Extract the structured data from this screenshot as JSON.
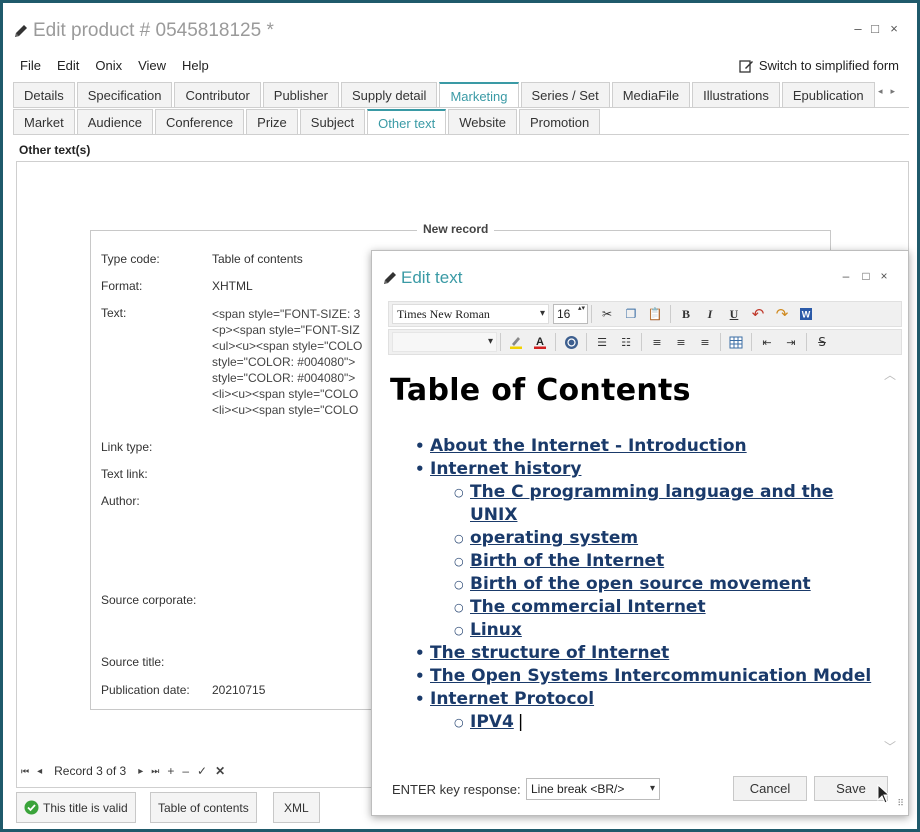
{
  "window": {
    "title": "Edit product # 0545818125 *",
    "controls": [
      "–",
      "□",
      "×"
    ]
  },
  "menu": [
    "File",
    "Edit",
    "Onix",
    "View",
    "Help"
  ],
  "simplified_label": "Switch to simplified form",
  "tabs_main": [
    "Details",
    "Specification",
    "Contributor",
    "Publisher",
    "Supply detail",
    "Marketing",
    "Series / Set",
    "MediaFile",
    "Illustrations",
    "Epublication"
  ],
  "tabs_main_active": "Marketing",
  "tabs_sub": [
    "Market",
    "Audience",
    "Conference",
    "Prize",
    "Subject",
    "Other text",
    "Website",
    "Promotion"
  ],
  "tabs_sub_active": "Other text",
  "section_title": "Other text(s)",
  "record": {
    "legend": "New record",
    "fields": {
      "type_code_label": "Type code:",
      "type_code_value": "Table of contents",
      "format_label": "Format:",
      "format_value": "XHTML",
      "text_label": "Text:",
      "text_lines": [
        "<span style=\"FONT-SIZE: 3",
        "<p><span style=\"FONT-SIZ",
        "<ul><u><span style=\"COLO",
        "style=\"COLOR: #004080\">",
        "style=\"COLOR: #004080\">",
        "<li><u><span style=\"COLO",
        "<li><u><span style=\"COLO"
      ],
      "link_type_label": "Link type:",
      "text_link_label": "Text link:",
      "author_label": "Author:",
      "source_corporate_label": "Source corporate:",
      "source_title_label": "Source title:",
      "publication_date_label": "Publication date:",
      "publication_date_value": "20210715"
    }
  },
  "navigator": {
    "record_text": "Record 3 of 3",
    "buttons": [
      "⏮",
      "◂",
      "▸",
      "⏭",
      "+",
      "–",
      "✓",
      "✕"
    ]
  },
  "bottom_buttons": {
    "valid": "This title is valid",
    "toc": "Table of contents",
    "xml": "XML"
  },
  "dialog": {
    "title": "Edit text",
    "controls": [
      "–",
      "□",
      "×"
    ],
    "font_name": "Times New Roman",
    "font_size": "16",
    "heading": "Table of Contents",
    "toc": [
      {
        "level": 1,
        "text": "About the Internet - Introduction"
      },
      {
        "level": 1,
        "text": "Internet history"
      },
      {
        "level": 2,
        "text": "The C programming language and the UNIX"
      },
      {
        "level": 2,
        "text": "operating system",
        "continuation": true
      },
      {
        "level": 2,
        "text": "Birth of the Internet"
      },
      {
        "level": 2,
        "text": "Birth of the open source movement"
      },
      {
        "level": 2,
        "text": "The commercial Internet"
      },
      {
        "level": 2,
        "text": "Linux"
      },
      {
        "level": 1,
        "text": "The structure of Internet"
      },
      {
        "level": 1,
        "text": "The Open Systems Intercommunication Model"
      },
      {
        "level": 1,
        "text": "Internet Protocol"
      },
      {
        "level": 2,
        "text": "IPV4"
      }
    ],
    "enter_label": "ENTER key response:",
    "enter_value": "Line break <BR/>",
    "cancel": "Cancel",
    "save": "Save"
  }
}
